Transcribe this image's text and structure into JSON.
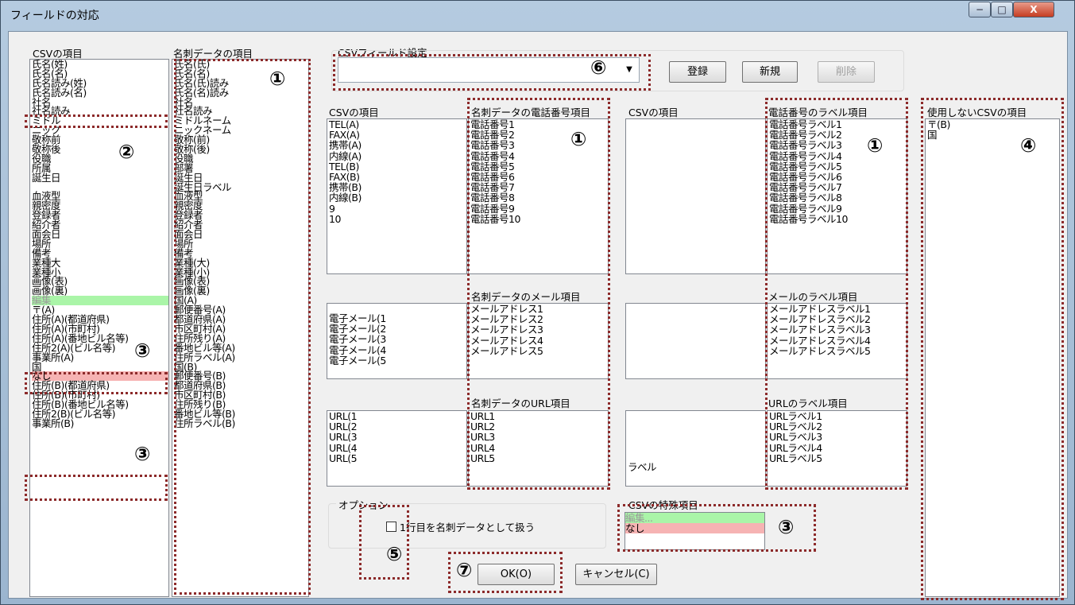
{
  "window": {
    "title": "フィールドの対応",
    "min": "−",
    "max": "□",
    "close": "X"
  },
  "left": {
    "csv_header": "CSVの項目",
    "csv_items": [
      "氏名(姓)",
      "氏名(名)",
      "氏名読み(姓)",
      "氏名読み(名)",
      "社名",
      "社名読み",
      "ミドル",
      "ニック",
      "敬称前",
      "敬称後",
      "役職",
      "所属",
      "誕生日",
      "",
      "血液型",
      "親密度",
      "登録者",
      "紹介者",
      "面会日",
      "場所",
      "備考",
      "業種大",
      "業種小",
      "画像(表)",
      "画像(裏)",
      "編集",
      "〒(A)",
      "住所(A)(都道府県)",
      "住所(A)(市町村)",
      "住所(A)(番地ビル名等)",
      "住所2(A)(ビル名等)",
      "事業所(A)",
      "国",
      "なし",
      "住所(B)(都道府県)",
      "住所(B)(市町村)",
      "住所(B)(番地ビル名等)",
      "住所2(B)(ビル名等)",
      "事業所(B)"
    ],
    "card_header": "名刺データの項目",
    "card_items": [
      "氏名(氏)",
      "氏名(名)",
      "氏名(氏)読み",
      "氏名(名)読み",
      "社名",
      "社名読み",
      "ミドルネーム",
      "ニックネーム",
      "敬称(前)",
      "敬称(後)",
      "役職",
      "部署",
      "誕生日",
      "誕生日ラベル",
      "血液型",
      "親密度",
      "登録者",
      "紹介者",
      "面会日",
      "場所",
      "備考",
      "業種(大)",
      "業種(小)",
      "画像(表)",
      "画像(裏)",
      "国(A)",
      "郵便番号(A)",
      "都道府県(A)",
      "市区町村(A)",
      "住所残り(A)",
      "番地ビル等(A)",
      "住所ラベル(A)",
      "国(B)",
      "郵便番号(B)",
      "都道府県(B)",
      "市区町村(B)",
      "住所残り(B)",
      "番地ビル等(B)",
      "住所ラベル(B)"
    ]
  },
  "csv_field_setting": {
    "label": "CSVフィールド設定",
    "combo_value": "",
    "register": "登録",
    "new": "新規",
    "delete": "削除"
  },
  "phone": {
    "csv_header": "CSVの項目",
    "csv_items": [
      "TEL(A)",
      "FAX(A)",
      "携帯(A)",
      "内線(A)",
      "TEL(B)",
      "FAX(B)",
      "携帯(B)",
      "内線(B)",
      "9",
      "10"
    ],
    "card_header": "名刺データの電話番号項目",
    "card_items": [
      "電話番号1",
      "電話番号2",
      "電話番号3",
      "電話番号4",
      "電話番号5",
      "電話番号6",
      "電話番号7",
      "電話番号8",
      "電話番号9",
      "電話番号10"
    ],
    "csv_label_header": "CSVの項目",
    "label_header": "電話番号のラベル項目",
    "label_items": [
      "電話番号ラベル1",
      "電話番号ラベル2",
      "電話番号ラベル3",
      "電話番号ラベル4",
      "電話番号ラベル5",
      "電話番号ラベル6",
      "電話番号ラベル7",
      "電話番号ラベル8",
      "電話番号ラベル9",
      "電話番号ラベル10"
    ]
  },
  "mail": {
    "csv_items": [
      "電子メール(1",
      "電子メール(2",
      "電子メール(3",
      "電子メール(4",
      "電子メール(5"
    ],
    "card_header": "名刺データのメール項目",
    "card_items": [
      "メールアドレス1",
      "メールアドレス2",
      "メールアドレス3",
      "メールアドレス4",
      "メールアドレス5"
    ],
    "label_header": "メールのラベル項目",
    "label_items": [
      "メールアドレスラベル1",
      "メールアドレスラベル2",
      "メールアドレスラベル3",
      "メールアドレスラベル4",
      "メールアドレスラベル5"
    ]
  },
  "url": {
    "csv_items": [
      "URL(1",
      "URL(2",
      "URL(3",
      "URL(4",
      "URL(5"
    ],
    "card_header": "名刺データのURL項目",
    "card_items": [
      "URL1",
      "URL2",
      "URL3",
      "URL4",
      "URL5"
    ],
    "label_csv_items": [
      "ラベル"
    ],
    "label_header": "URLのラベル項目",
    "label_items": [
      "URLラベル1",
      "URLラベル2",
      "URLラベル3",
      "URLラベル4",
      "URLラベル5"
    ]
  },
  "unused": {
    "header": "使用しないCSVの項目",
    "items": [
      "〒(B)",
      "国"
    ]
  },
  "options": {
    "label": "オプション",
    "checkbox_label": "1行目を名刺データとして扱う"
  },
  "special": {
    "label": "CSVの特殊項目",
    "items": [
      "編集...",
      "なし"
    ]
  },
  "buttons": {
    "ok": "OK(O)",
    "cancel": "キャンセル(C)"
  },
  "annotations": {
    "n1": "①",
    "n2": "②",
    "n3": "③",
    "n4": "④",
    "n5": "⑤",
    "n6": "⑥",
    "n7": "⑦"
  }
}
